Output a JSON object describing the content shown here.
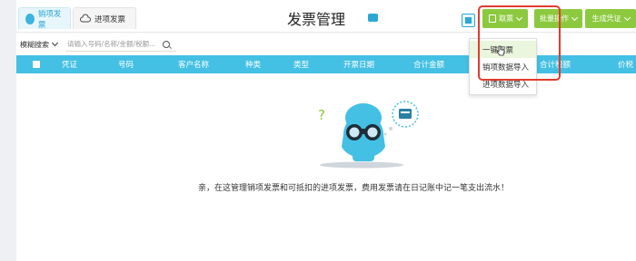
{
  "tabs": [
    {
      "label": "销项发票",
      "active": true
    },
    {
      "label": "进项发票",
      "active": false
    }
  ],
  "header": {
    "title": "发票管理"
  },
  "toolbar": {
    "fetch_label": "取票",
    "batch_label": "批量操作",
    "generate_label": "生成凭证"
  },
  "dropdown": {
    "items": [
      "一键取票",
      "销项数据导入",
      "进项数据导入"
    ],
    "hovered_index": 0
  },
  "filter": {
    "mode_label": "模糊搜索",
    "search_placeholder": "请输入号码/名称/金额/税额..."
  },
  "table": {
    "columns": [
      "凭证",
      "号码",
      "客户名称",
      "种类",
      "类型",
      "开票日期",
      "合计金额",
      "合计税额",
      "价税"
    ]
  },
  "empty_state": {
    "message": "亲，在这管理销项发票和可抵扣的进项发票，费用发票请在日记账中记一笔支出流水！"
  },
  "colors": {
    "accent_blue": "#43c0e3",
    "button_green": "#8cc93e",
    "highlight_red": "#e23b2e"
  }
}
